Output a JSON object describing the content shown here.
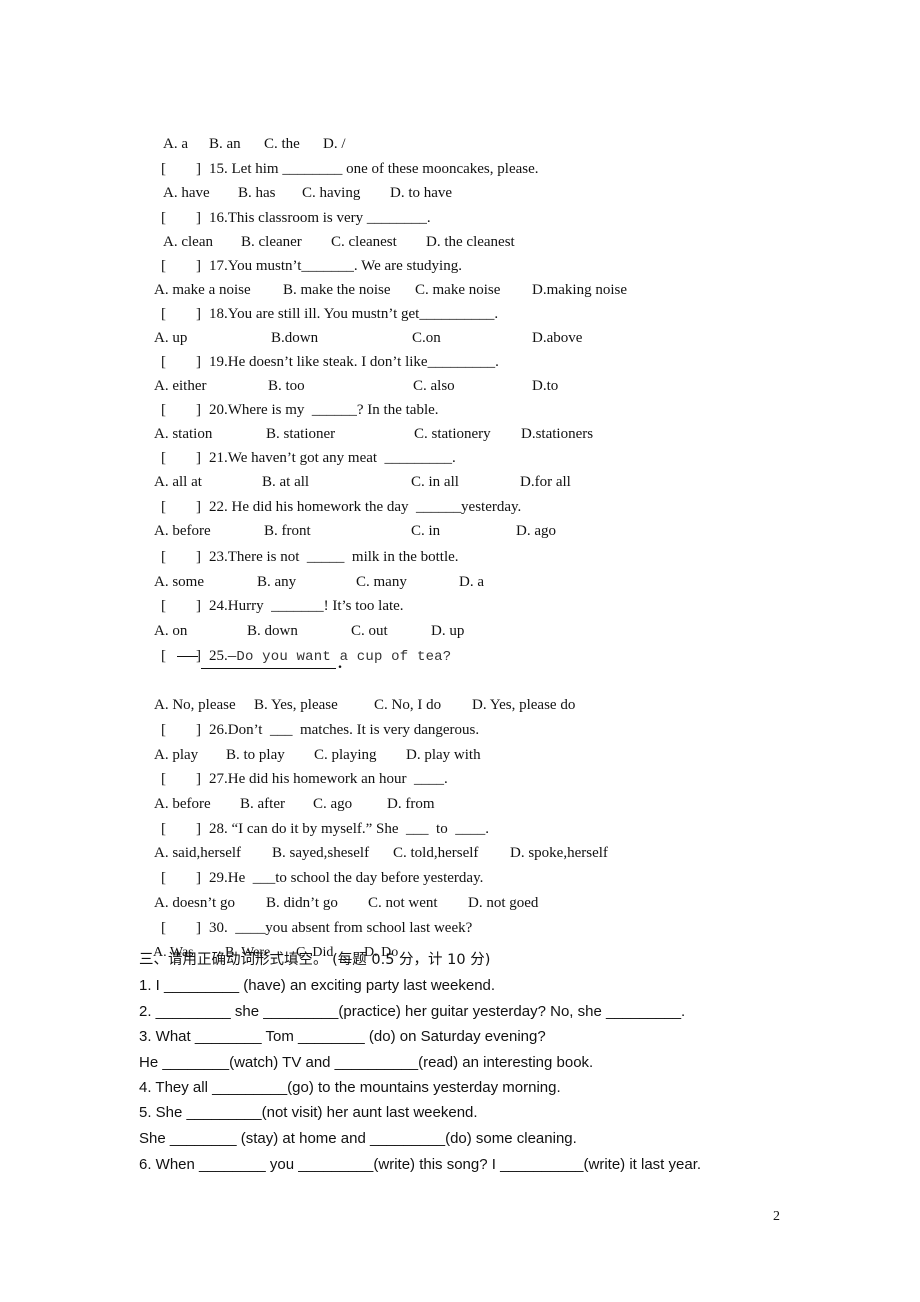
{
  "doc": {
    "page_number": "2",
    "q14_options": [
      "A. a",
      "B. an",
      "C. the",
      "D. /"
    ],
    "questions": [
      {
        "bracket": "[        ]",
        "text": "15. Let him ________ one of these mooncakes, please.",
        "options": [
          "A. have",
          "B. has",
          "C. having",
          "D. to have"
        ]
      },
      {
        "bracket": "[        ]",
        "text": "16.This classroom is very ________.",
        "options": [
          "A. clean",
          "B. cleaner",
          "C. cleanest",
          "D. the cleanest"
        ]
      },
      {
        "bracket": "[        ]",
        "text": "17.You mustn’t_______. We are studying.",
        "options": [
          "A. make a noise",
          "B. make the noise",
          "C. make noise",
          "D.making noise"
        ]
      },
      {
        "bracket": "[        ]",
        "text": "18.You are still ill. You mustn’t get__________.",
        "options": [
          "A. up",
          "B.down",
          "C.on",
          "D.above"
        ]
      },
      {
        "bracket": "[        ]",
        "text": "19.He doesn’t like steak. I don’t like_________.",
        "options": [
          "A. either",
          "B. too",
          "C. also",
          "D.to"
        ]
      },
      {
        "bracket": "[        ]",
        "text": "20.Where is my  ______? In the table.",
        "options": [
          "A. station",
          "B. stationer",
          "C. stationery",
          "D.stationers"
        ]
      },
      {
        "bracket": "[        ]",
        "text": "21.We haven’t got any meat  _________.",
        "options": [
          "A. all at",
          "B. at all",
          "C. in all",
          "D.for all"
        ]
      },
      {
        "bracket": "[        ]",
        "text": "22. He did his homework the day  ______yesterday.",
        "options": [
          "A. before",
          "B. front",
          "C. in",
          "D. ago"
        ]
      },
      {
        "bracket": "[        ]",
        "text": "23.There is not  _____  milk in the bottle.",
        "options": [
          "A. some",
          "B. any",
          "C. many",
          "D. a"
        ]
      },
      {
        "bracket": "[        ]",
        "text": "24.Hurry  _______! It’s too late.",
        "options": [
          "A. on",
          "B. down",
          "C. out",
          "D. up"
        ]
      },
      {
        "bracket": "[        ]",
        "text_num": "25.",
        "text": "—Do you want a cup of tea?",
        "options": [
          "A. No, please",
          "B. Yes, please",
          "C. No, I do",
          "D. Yes, please do"
        ]
      },
      {
        "bracket": "[        ]",
        "text": "26.Don’t  ___  matches. It is very dangerous.",
        "options": [
          "A. play",
          "B. to play",
          "C. playing",
          "D. play with"
        ]
      },
      {
        "bracket": "[        ]",
        "text": "27.He did his homework an hour  ____.",
        "options": [
          "A. before",
          "B. after",
          "C. ago",
          "D. from"
        ]
      },
      {
        "bracket": "[        ]",
        "text": "28. “I can do it by myself.” She  ___  to  ____.",
        "options": [
          "A. said,herself",
          "B. sayed,sheself",
          "C. told,herself",
          "D. spoke,herself"
        ]
      },
      {
        "bracket": "[        ]",
        "text": "29.He  ___to school the day before yesterday.",
        "options": [
          "A. doesn’t go",
          "B. didn’t go",
          "C. not went",
          "D. not goed"
        ]
      },
      {
        "bracket": "[        ]",
        "text": "30.  ____you absent from school last week?",
        "options": [
          "A. Was",
          "B. Were",
          "C. Did",
          "D. Do"
        ]
      }
    ],
    "section3": {
      "heading": "三、请用正确动词形式填空。 (每题 0.5 分，计 10 分)",
      "lines": [
        "1. I _________ (have) an exciting party last weekend.",
        "2. _________ she _________(practice) her guitar yesterday? No, she _________.",
        "3. What ________ Tom ________ (do) on Saturday evening?",
        "He ________(watch) TV and __________(read) an interesting book.",
        "4. They all _________(go) to the mountains yesterday morning.",
        "5. She _________(not visit) her aunt last weekend.",
        "She ________ (stay) at home and _________(do) some cleaning.",
        "6. When ________ you _________(write) this song? I __________(write) it last year."
      ]
    }
  }
}
